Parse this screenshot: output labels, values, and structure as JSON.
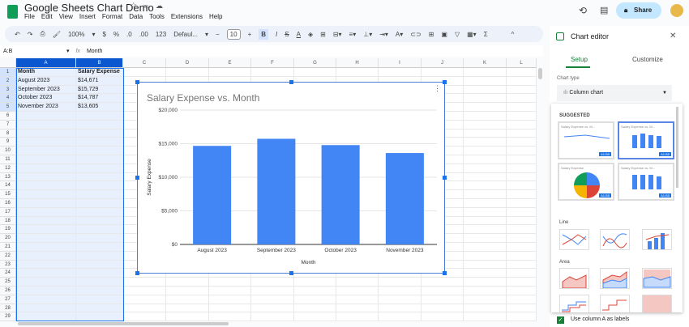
{
  "doc": {
    "title": "Google Sheets Chart Demo",
    "menu": [
      "File",
      "Edit",
      "View",
      "Insert",
      "Format",
      "Data",
      "Tools",
      "Extensions",
      "Help"
    ],
    "share": "Share"
  },
  "toolbar": {
    "zoom": "100%",
    "currency": "$",
    "percent": "%",
    "dec_minus": ".0",
    "dec_plus": ".00",
    "format123": "123",
    "font": "Defaul...",
    "font_size": "10",
    "bold": "B",
    "italic": "I"
  },
  "formula": {
    "range": "A:B",
    "fx": "fx",
    "value": "Month"
  },
  "grid": {
    "columns": [
      "A",
      "B",
      "C",
      "D",
      "E",
      "F",
      "G",
      "H",
      "I",
      "J",
      "K",
      "L"
    ],
    "rows": [
      [
        "Month",
        "Salary Expense"
      ],
      [
        "August 2023",
        "$14,671"
      ],
      [
        "September 2023",
        "$15,729"
      ],
      [
        "October 2023",
        "$14,787"
      ],
      [
        "November 2023",
        "$13,605"
      ]
    ],
    "row_count": 29
  },
  "chart_data": {
    "type": "bar",
    "title": "Salary Expense vs. Month",
    "xlabel": "Month",
    "ylabel": "Salary Expense",
    "categories": [
      "August 2023",
      "September 2023",
      "October 2023",
      "November 2023"
    ],
    "values": [
      14671,
      15729,
      14787,
      13605
    ],
    "ylim": [
      0,
      20000
    ],
    "yticks": [
      "$0",
      "$5,000",
      "$10,000",
      "$15,000",
      "$20,000"
    ],
    "grid": true,
    "color": "#4285f4"
  },
  "editor": {
    "title": "Chart editor",
    "tabs": [
      "Setup",
      "Customize"
    ],
    "chart_type_label": "Chart type",
    "chart_type": "Column chart",
    "suggested": "SUGGESTED",
    "line": "Line",
    "area": "Area",
    "thumb_title": "Salary Expense vs. M...",
    "pie_title": "Salary Expense",
    "range_badge": "A1:B5",
    "use_col_a": "Use column A as labels",
    "use_col_a_checked": true
  }
}
